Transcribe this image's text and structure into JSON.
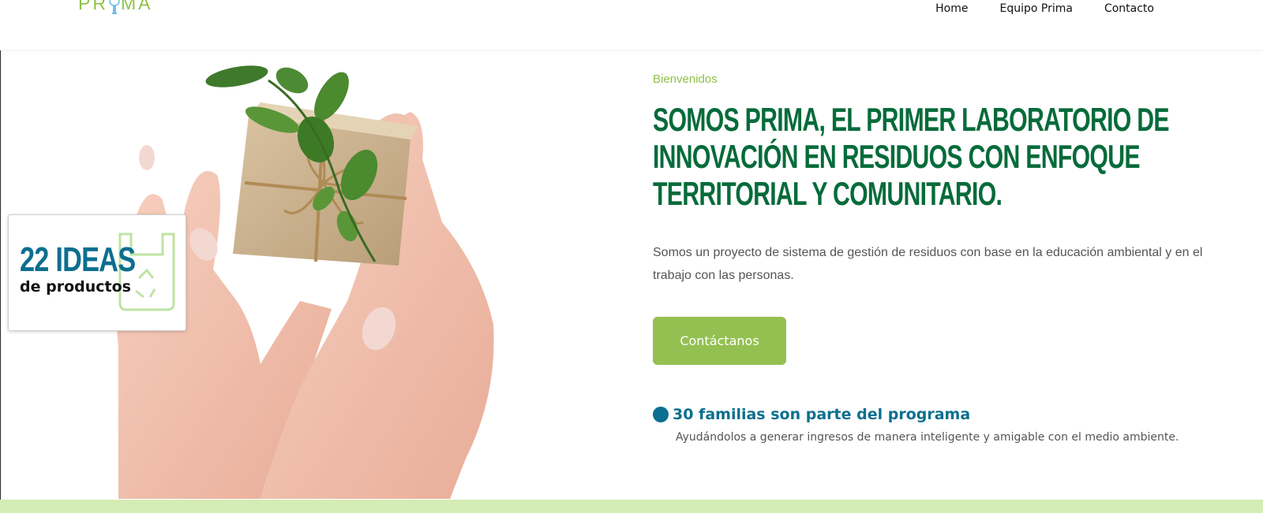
{
  "header": {
    "logo_text": "PRIMA",
    "nav": [
      {
        "label": "Home"
      },
      {
        "label": "Equipo Prima"
      },
      {
        "label": "Contacto"
      }
    ]
  },
  "hero_card": {
    "number_text": "22 IDEAS",
    "sub_text": "de productos"
  },
  "content": {
    "eyebrow": "Bienvenidos",
    "headline": "Somos PRIMA, el primer laboratorio de innovación en residuos con enfoque territorial y comunitario.",
    "description": "Somos un proyecto de sistema de gestión de residuos con base en la educación ambiental y en el trabajo con las personas.",
    "cta_label": "Contáctanos",
    "stat_title": "30 familias son parte del programa",
    "stat_text": "Ayudándolos a generar ingresos de manera inteligente y amigable con el medio ambiente."
  },
  "colors": {
    "brand_green": "#8ec14b",
    "headline_green": "#066b3a",
    "accent_blue": "#0c6f8f",
    "cta_green": "#94c052",
    "band_green": "#d4ecb5"
  },
  "icons": {
    "logo_bulb": "lightbulb-icon",
    "card_bag": "reusable-bag-icon",
    "stat_dot": "dot-icon"
  }
}
